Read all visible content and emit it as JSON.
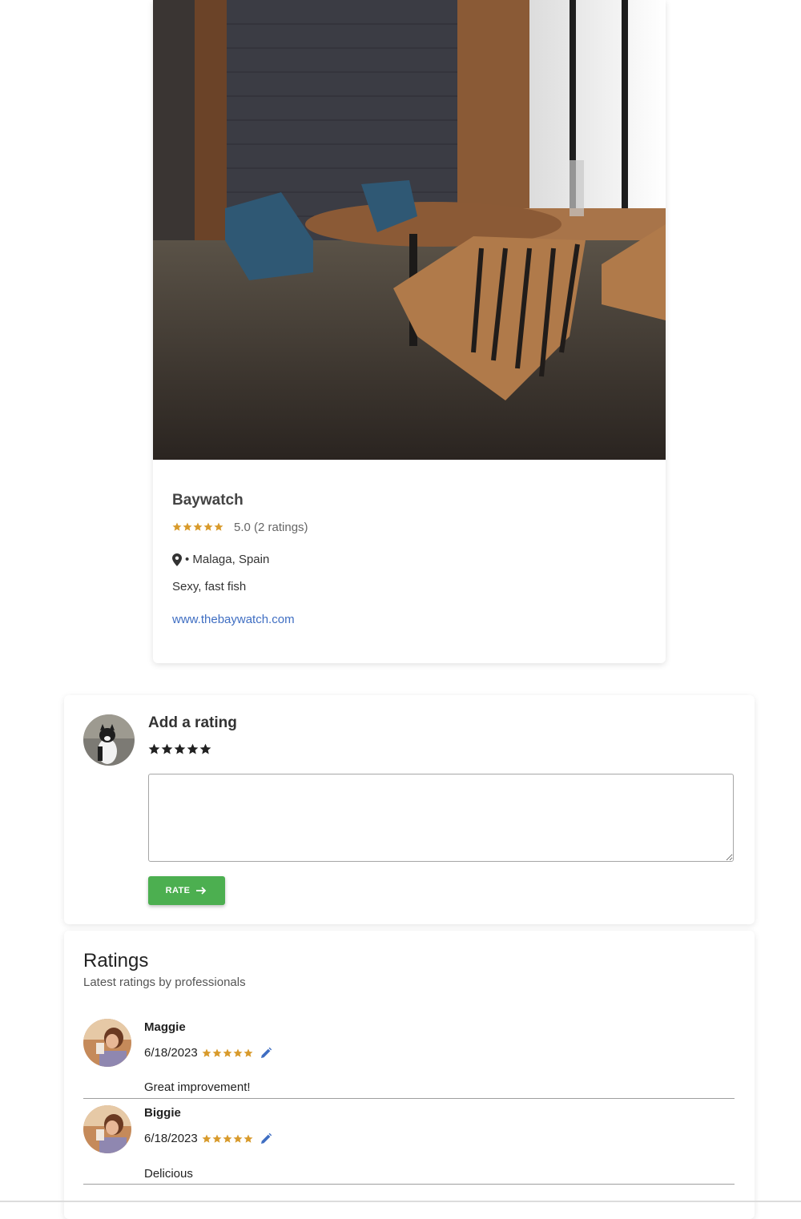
{
  "restaurant": {
    "name": "Baywatch",
    "rating_value": 5,
    "rating_text": "5.0 (2 ratings)",
    "location": "• Malaga, Spain",
    "description": "Sexy, fast fish",
    "website": "www.thebaywatch.com"
  },
  "add_rating": {
    "title": "Add a rating",
    "selected_stars": 5,
    "comment_value": "",
    "button_label": "RATE"
  },
  "ratings": {
    "title": "Ratings",
    "subtitle": "Latest ratings by professionals",
    "items": [
      {
        "name": "Maggie",
        "date": "6/18/2023",
        "stars": 5,
        "text": "Great improvement!"
      },
      {
        "name": "Biggie",
        "date": "6/18/2023",
        "stars": 5,
        "text": "Delicious"
      }
    ]
  },
  "colors": {
    "star_gold": "#d89a2b",
    "star_dark": "#212121",
    "link_blue": "#3f6ec2",
    "button_green": "#4caf50",
    "edit_blue": "#3f6ec2"
  },
  "icons": {
    "location": "map-pin-icon",
    "edit": "pencil-icon",
    "arrow": "arrow-right-icon",
    "star": "star-icon"
  }
}
